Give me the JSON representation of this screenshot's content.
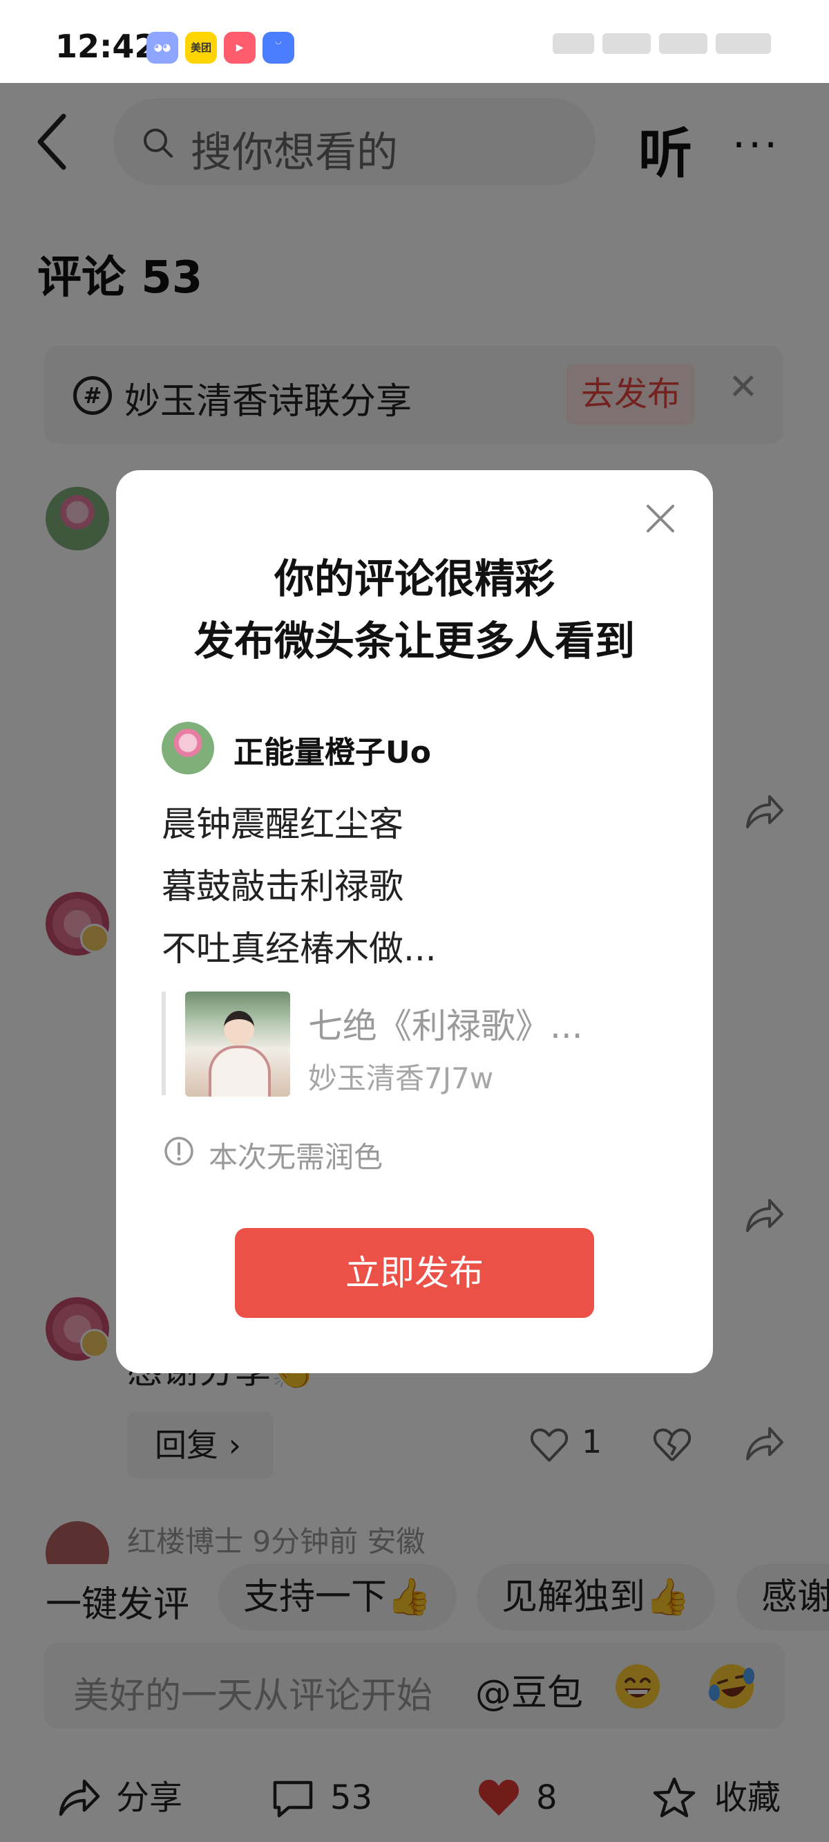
{
  "status_bar": {
    "time": "12:42",
    "apps": [
      "美团"
    ]
  },
  "header": {
    "search_placeholder": "搜你想看的",
    "listen_label": "听",
    "more_label": "···"
  },
  "comments_title": "评论 53",
  "topic": {
    "text": "妙玉清香诗联分享",
    "publish_label": "去发布",
    "close_label": "✕"
  },
  "comment": {
    "text": "感谢分享👏",
    "reply_label": "回复 ›",
    "like_count": "1",
    "next_commenter": "红楼博士  9分钟前  安徽"
  },
  "quick_replies": {
    "label": "一键发评",
    "chips": [
      "支持一下👍",
      "见解独到👍",
      "感谢"
    ]
  },
  "input": {
    "placeholder": "美好的一天从评论开始",
    "mention": "@豆包"
  },
  "bottom_bar": {
    "share": "分享",
    "comments": "53",
    "likes": "8",
    "favorite": "收藏"
  },
  "modal": {
    "title_line_1": "你的评论很精彩",
    "title_line_2": "发布微头条让更多人看到",
    "username": "正能量橙子Uo",
    "lines": [
      "晨钟震醒红尘客",
      "暮鼓敲击利禄歌",
      "不吐真经椿木做..."
    ],
    "quote_title": "七绝《利禄歌》...",
    "quote_author": "妙玉清香7J7w",
    "info": "本次无需润色",
    "publish_label": "立即发布"
  },
  "colors": {
    "accent": "#ec5148",
    "like_red": "#e53935",
    "overlay": "rgba(0,0,0,0.5)"
  }
}
